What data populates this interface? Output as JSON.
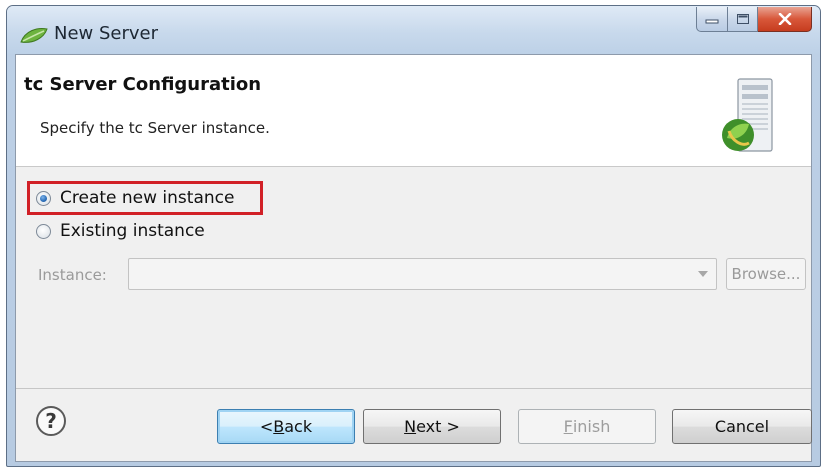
{
  "window": {
    "title": "New Server",
    "icon": "spring-leaf-icon",
    "controls": {
      "minimize": "minimize-icon",
      "maximize": "maximize-icon",
      "close": "close-icon"
    }
  },
  "banner": {
    "title": "tc Server Configuration",
    "description": "Specify the tc Server instance.",
    "icon": "server-icon"
  },
  "options": {
    "create_new": {
      "label": "Create new instance",
      "selected": true
    },
    "existing": {
      "label": "Existing instance",
      "selected": false
    }
  },
  "instance": {
    "label": "Instance:",
    "value": "",
    "browse_label": "Browse..."
  },
  "footer": {
    "help_icon": "help-icon",
    "back_prefix": "< ",
    "back_mnemonic": "B",
    "back_rest": "ack",
    "next_mnemonic": "N",
    "next_rest": "ext >",
    "finish_mnemonic": "F",
    "finish_rest": "inish",
    "cancel_label": "Cancel"
  },
  "colors": {
    "highlight": "#d12027",
    "titlebar": "#c8d9ec",
    "dialog_bg": "#f0f0f0"
  }
}
